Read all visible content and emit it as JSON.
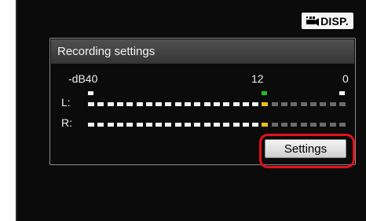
{
  "disp_button": {
    "label": "DISP.",
    "icon": "movie-camera-icon"
  },
  "panel": {
    "title": "Recording settings"
  },
  "meter": {
    "scale": {
      "low": "-dB40",
      "mid": "12",
      "high": "0"
    },
    "channels": [
      {
        "label": "L:",
        "lit_segments": 19,
        "total_segments": 27
      },
      {
        "label": "R:",
        "lit_segments": 19,
        "total_segments": 27
      }
    ],
    "colors": {
      "white": "#f2f2f2",
      "yellow": "#e8c21a",
      "green": "#21c21a",
      "grey": "#6b6b6b"
    }
  },
  "settings_button": {
    "label": "Settings"
  },
  "colors": {
    "highlight": "#e3111b",
    "screen": "#0b0b0b",
    "header": "#404040"
  }
}
